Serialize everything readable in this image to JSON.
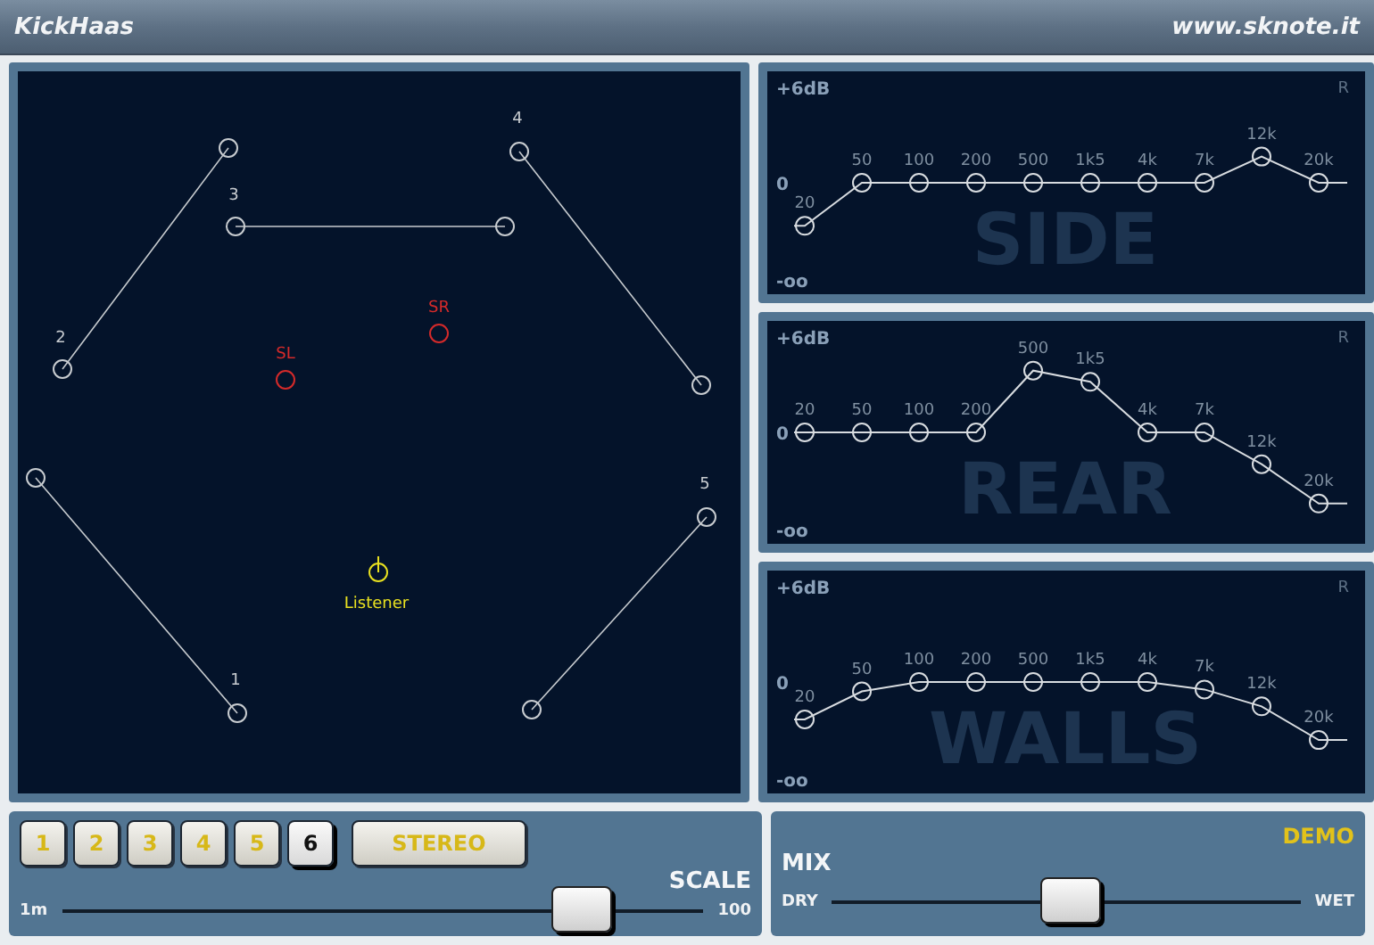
{
  "title_bar": {
    "app_name": "KickHaas",
    "website": "www.sknote.it"
  },
  "room": {
    "walls": [
      {
        "label": "1"
      },
      {
        "label": "2"
      },
      {
        "label": "3"
      },
      {
        "label": "4"
      },
      {
        "label": "5"
      }
    ],
    "sources": [
      {
        "label": "SL"
      },
      {
        "label": "SR"
      }
    ],
    "listener": {
      "label": "Listener"
    }
  },
  "eq_panels": [
    {
      "name": "SIDE",
      "top_label": "+6dB",
      "zero_label": "0",
      "bottom_label": "-oo",
      "corner_label": "R",
      "bands": [
        {
          "freq": "20",
          "level": 0.27
        },
        {
          "freq": "50",
          "level": 0.5
        },
        {
          "freq": "100",
          "level": 0.5
        },
        {
          "freq": "200",
          "level": 0.5
        },
        {
          "freq": "500",
          "level": 0.5
        },
        {
          "freq": "1k5",
          "level": 0.5
        },
        {
          "freq": "4k",
          "level": 0.5
        },
        {
          "freq": "7k",
          "level": 0.5
        },
        {
          "freq": "12k",
          "level": 0.64
        },
        {
          "freq": "20k",
          "level": 0.5
        }
      ]
    },
    {
      "name": "REAR",
      "top_label": "+6dB",
      "zero_label": "0",
      "bottom_label": "-oo",
      "corner_label": "R",
      "bands": [
        {
          "freq": "20",
          "level": 0.5
        },
        {
          "freq": "50",
          "level": 0.5
        },
        {
          "freq": "100",
          "level": 0.5
        },
        {
          "freq": "200",
          "level": 0.5
        },
        {
          "freq": "500",
          "level": 0.83
        },
        {
          "freq": "1k5",
          "level": 0.77
        },
        {
          "freq": "4k",
          "level": 0.5
        },
        {
          "freq": "7k",
          "level": 0.5
        },
        {
          "freq": "12k",
          "level": 0.33
        },
        {
          "freq": "20k",
          "level": 0.12
        }
      ]
    },
    {
      "name": "WALLS",
      "top_label": "+6dB",
      "zero_label": "0",
      "bottom_label": "-oo",
      "corner_label": "R",
      "bands": [
        {
          "freq": "20",
          "level": 0.3
        },
        {
          "freq": "50",
          "level": 0.45
        },
        {
          "freq": "100",
          "level": 0.5
        },
        {
          "freq": "200",
          "level": 0.5
        },
        {
          "freq": "500",
          "level": 0.5
        },
        {
          "freq": "1k5",
          "level": 0.5
        },
        {
          "freq": "4k",
          "level": 0.5
        },
        {
          "freq": "7k",
          "level": 0.46
        },
        {
          "freq": "12k",
          "level": 0.37
        },
        {
          "freq": "20k",
          "level": 0.19
        }
      ]
    }
  ],
  "presets": [
    {
      "label": "1",
      "selected": false
    },
    {
      "label": "2",
      "selected": false
    },
    {
      "label": "3",
      "selected": false
    },
    {
      "label": "4",
      "selected": false
    },
    {
      "label": "5",
      "selected": false
    },
    {
      "label": "6",
      "selected": true
    }
  ],
  "stereo_button": "STEREO",
  "scale": {
    "label": "SCALE",
    "min_label": "1m",
    "max_label": "100",
    "level": 0.81
  },
  "mix": {
    "badge": "DEMO",
    "label": "MIX",
    "min_label": "DRY",
    "max_label": "WET",
    "level": 0.51
  }
}
